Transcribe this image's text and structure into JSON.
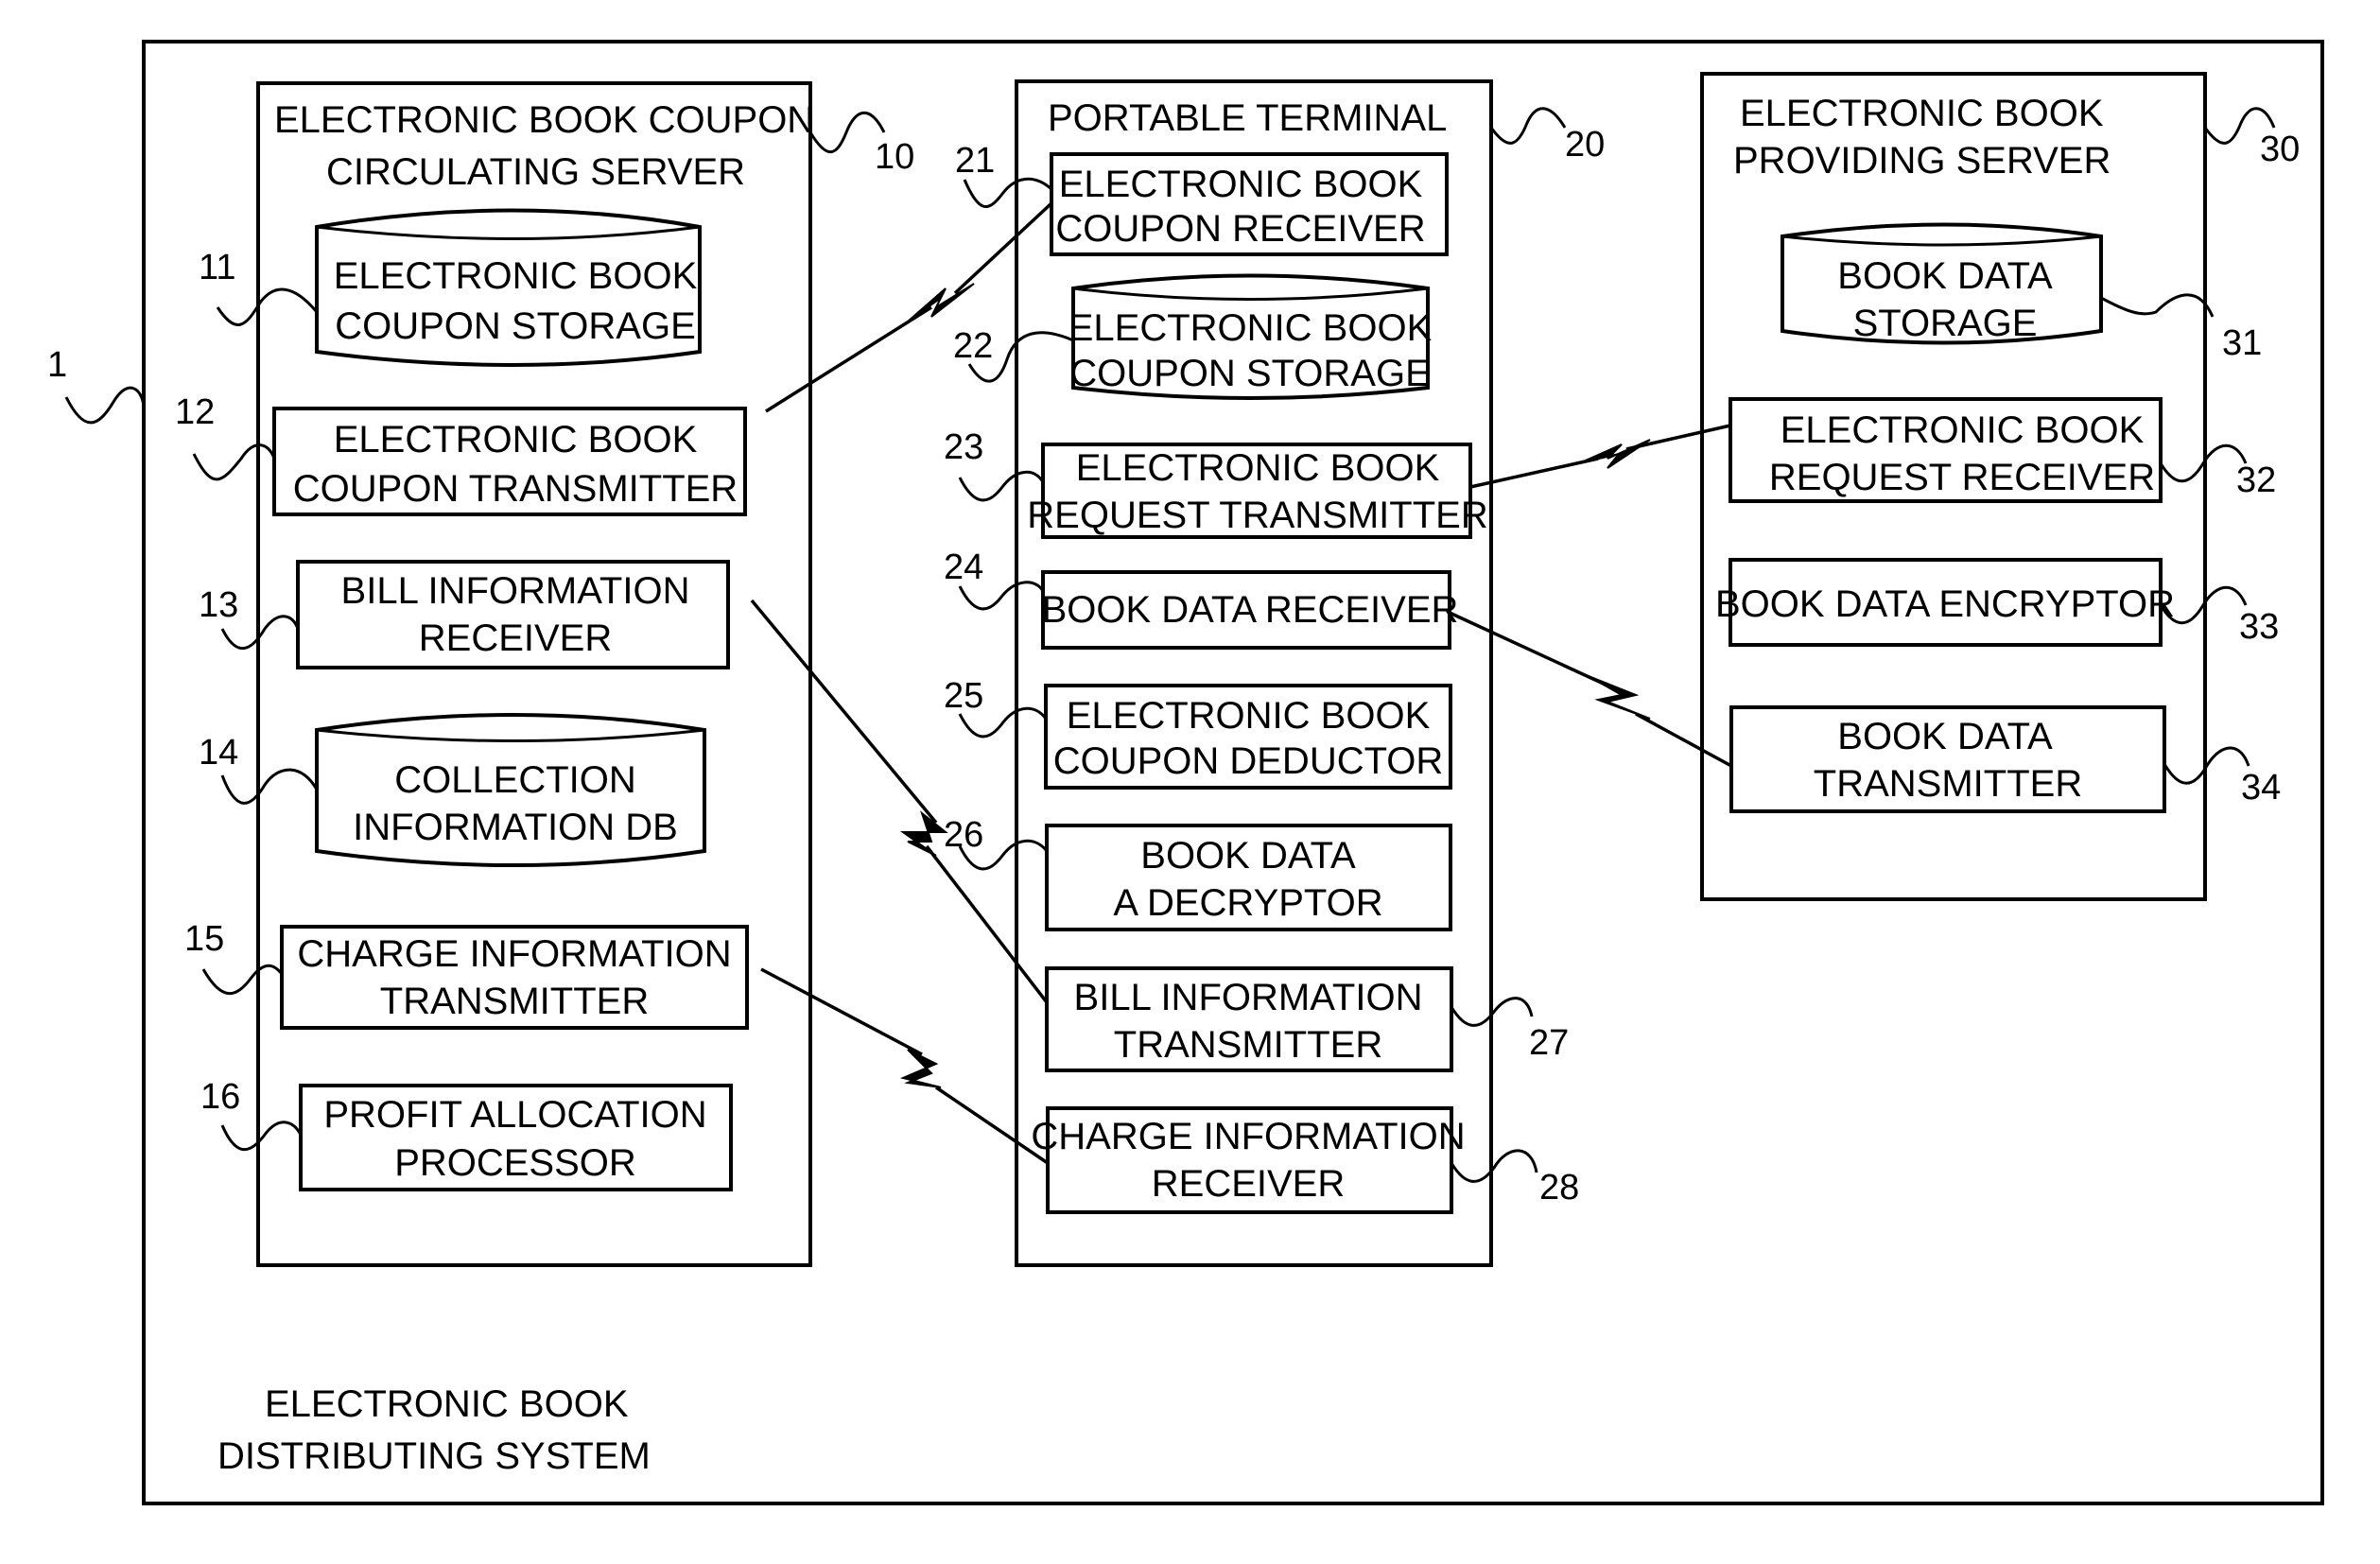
{
  "system": {
    "ref": "1",
    "caption_line1": "ELECTRONIC BOOK",
    "caption_line2": "DISTRIBUTING SYSTEM"
  },
  "coupon_server": {
    "ref": "10",
    "title_line1": "ELECTRONIC BOOK COUPON",
    "title_line2": "CIRCULATING SERVER",
    "components": [
      {
        "ref": "11",
        "type": "storage",
        "line1": "ELECTRONIC BOOK",
        "line2": "COUPON STORAGE"
      },
      {
        "ref": "12",
        "type": "block",
        "line1": "ELECTRONIC BOOK",
        "line2": "COUPON TRANSMITTER"
      },
      {
        "ref": "13",
        "type": "block",
        "line1": "BILL INFORMATION",
        "line2": "RECEIVER"
      },
      {
        "ref": "14",
        "type": "storage",
        "line1": "COLLECTION",
        "line2": "INFORMATION DB"
      },
      {
        "ref": "15",
        "type": "block",
        "line1": "CHARGE INFORMATION",
        "line2": "TRANSMITTER"
      },
      {
        "ref": "16",
        "type": "block",
        "line1": "PROFIT ALLOCATION",
        "line2": "PROCESSOR"
      }
    ]
  },
  "portable_terminal": {
    "ref": "20",
    "title": "PORTABLE TERMINAL",
    "components": [
      {
        "ref": "21",
        "type": "block",
        "line1": "ELECTRONIC BOOK",
        "line2": "COUPON RECEIVER"
      },
      {
        "ref": "22",
        "type": "storage",
        "line1": "ELECTRONIC BOOK",
        "line2": "COUPON STORAGE"
      },
      {
        "ref": "23",
        "type": "block",
        "line1": "ELECTRONIC BOOK",
        "line2": "REQUEST TRANSMITTER"
      },
      {
        "ref": "24",
        "type": "block",
        "line1": "BOOK DATA RECEIVER",
        "line2": ""
      },
      {
        "ref": "25",
        "type": "block",
        "line1": "ELECTRONIC BOOK",
        "line2": "COUPON DEDUCTOR"
      },
      {
        "ref": "26",
        "type": "block",
        "line1": "BOOK DATA",
        "line2": "A DECRYPTOR"
      },
      {
        "ref": "27",
        "type": "block",
        "line1": "BILL INFORMATION",
        "line2": "TRANSMITTER"
      },
      {
        "ref": "28",
        "type": "block",
        "line1": "CHARGE INFORMATION",
        "line2": "RECEIVER"
      }
    ]
  },
  "providing_server": {
    "ref": "30",
    "title_line1": "ELECTRONIC BOOK",
    "title_line2": "PROVIDING SERVER",
    "components": [
      {
        "ref": "31",
        "type": "storage",
        "line1": "BOOK DATA",
        "line2": "STORAGE"
      },
      {
        "ref": "32",
        "type": "block",
        "line1": "ELECTRONIC BOOK",
        "line2": "REQUEST RECEIVER"
      },
      {
        "ref": "33",
        "type": "block",
        "line1": "BOOK DATA ENCRYPTOR",
        "line2": ""
      },
      {
        "ref": "34",
        "type": "block",
        "line1": "BOOK DATA",
        "line2": "TRANSMITTER"
      }
    ]
  },
  "links": [
    {
      "from": "12",
      "to": "21",
      "kind": "wireless"
    },
    {
      "from": "23",
      "to": "32",
      "kind": "wireless"
    },
    {
      "from": "24",
      "to": "34",
      "kind": "wireless"
    },
    {
      "from": "13",
      "to": "27",
      "kind": "wireless"
    },
    {
      "from": "15",
      "to": "28",
      "kind": "wireless"
    }
  ]
}
